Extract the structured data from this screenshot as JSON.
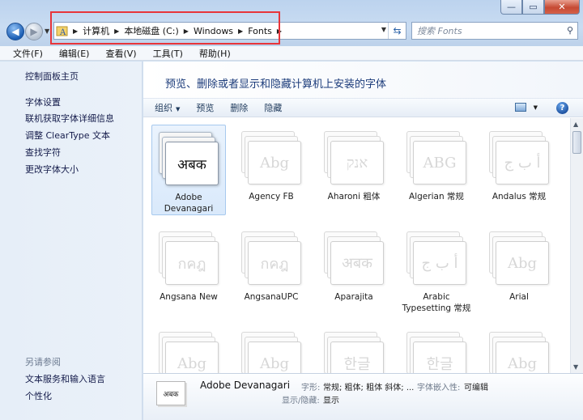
{
  "window": {
    "controls": {
      "minimize": "—",
      "maximize": "▭",
      "close": "✕"
    }
  },
  "address": {
    "crumbs": [
      "计算机",
      "本地磁盘 (C:)",
      "Windows",
      "Fonts"
    ],
    "search_placeholder": "搜索 Fonts"
  },
  "menu": [
    "文件(F)",
    "编辑(E)",
    "查看(V)",
    "工具(T)",
    "帮助(H)"
  ],
  "sidebar": {
    "home": "控制面板主页",
    "links": [
      "字体设置",
      "联机获取字体详细信息",
      "调整 ClearType 文本",
      "查找字符",
      "更改字体大小"
    ],
    "see_also_heading": "另请参阅",
    "see_also": [
      "文本服务和输入语言",
      "个性化"
    ]
  },
  "header": {
    "title": "预览、删除或者显示和隐藏计算机上安装的字体"
  },
  "toolbar": {
    "organize": "组织",
    "preview": "预览",
    "delete": "删除",
    "hide": "隐藏"
  },
  "fonts": [
    {
      "sample": "अबक",
      "label": "Adobe Devanagari",
      "selected": true
    },
    {
      "sample": "Abg",
      "label": "Agency FB"
    },
    {
      "sample": "אנק",
      "label": "Aharoni 粗体"
    },
    {
      "sample": "ABG",
      "label": "Algerian 常规"
    },
    {
      "sample": "أ ب ج",
      "label": "Andalus 常规"
    },
    {
      "sample": "กคฎ",
      "label": "Angsana New"
    },
    {
      "sample": "กคฎ",
      "label": "AngsanaUPC"
    },
    {
      "sample": "अबक",
      "label": "Aparajita"
    },
    {
      "sample": "أ ب ج",
      "label": "Arabic Typesetting 常规"
    },
    {
      "sample": "Abg",
      "label": "Arial"
    },
    {
      "sample": "Abg",
      "label": ""
    },
    {
      "sample": "Abg",
      "label": ""
    },
    {
      "sample": "한글",
      "label": ""
    },
    {
      "sample": "한글",
      "label": ""
    },
    {
      "sample": "Abg",
      "label": ""
    }
  ],
  "details": {
    "thumb": "अबक",
    "name": "Adobe Devanagari",
    "style_label": "字形:",
    "style_value": "常规; 粗体; 粗体 斜体; ...",
    "embed_label": "字体嵌入性:",
    "embed_value": "可编辑",
    "show_label": "显示/隐藏:",
    "show_value": "显示"
  }
}
